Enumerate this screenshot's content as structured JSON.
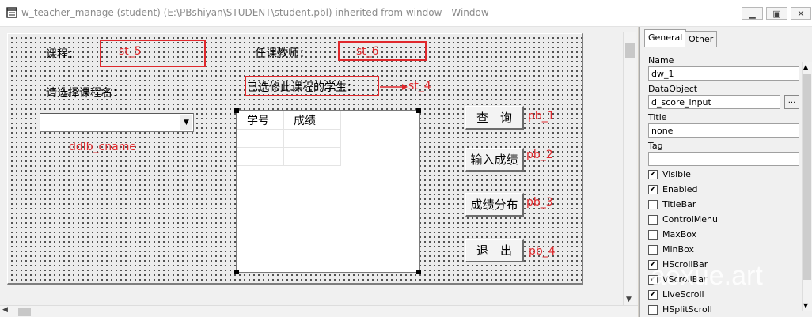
{
  "window": {
    "title": "w_teacher_manage (student) (E:\\PBshiyan\\STUDENT\\student.pbl) inherited from window - Window"
  },
  "form": {
    "course_label": "课程：",
    "st_5": "st_5",
    "teacher_label": "任课教师：",
    "st_6": "st_6",
    "select_course_label": "请选择课程名：",
    "st_4_text": "已选修此课程的学生：",
    "st_4_name": "st_4",
    "ddlb_name": "ddlb_cname",
    "dw_headers": [
      "学号",
      "成绩"
    ],
    "buttons": [
      {
        "label": "查　询",
        "name": "pb_1"
      },
      {
        "label": "输入成绩",
        "name": "pb_2"
      },
      {
        "label": "成绩分布",
        "name": "pb_3"
      },
      {
        "label": "退　出",
        "name": "pb_4"
      }
    ]
  },
  "properties": {
    "tabs": [
      "General",
      "Other"
    ],
    "fields": [
      {
        "label": "Name",
        "value": "dw_1"
      },
      {
        "label": "DataObject",
        "value": "d_score_input"
      },
      {
        "label": "Title",
        "value": "none"
      },
      {
        "label": "Tag",
        "value": ""
      }
    ],
    "browse_label": "...",
    "checkboxes": [
      {
        "label": "Visible",
        "checked": true
      },
      {
        "label": "Enabled",
        "checked": true
      },
      {
        "label": "TitleBar",
        "checked": false
      },
      {
        "label": "ControlMenu",
        "checked": false
      },
      {
        "label": "MaxBox",
        "checked": false
      },
      {
        "label": "MinBox",
        "checked": false
      },
      {
        "label": "HScrollBar",
        "checked": true
      },
      {
        "label": "VScrollBar",
        "checked": true
      },
      {
        "label": "LiveScroll",
        "checked": true
      },
      {
        "label": "HSplitScroll",
        "checked": false
      }
    ]
  },
  "watermark": "aoxue.art"
}
